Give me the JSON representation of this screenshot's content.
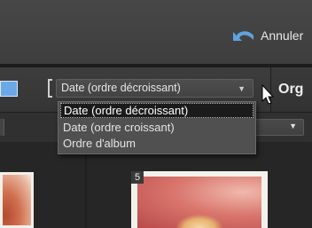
{
  "toolbar": {
    "undo_label": "Annuler",
    "undo_icon": "undo-arrow-icon",
    "workspace_tab_label": "Org"
  },
  "sort": {
    "selected": "Date  (ordre décroissant)",
    "options": [
      "Date  (ordre décroissant)",
      "Date  (ordre croissant)",
      "Ordre d'album"
    ]
  },
  "thumbnails": [
    {
      "badge": ""
    },
    {
      "badge": "5"
    }
  ],
  "colors": {
    "accent_blue": "#6aa9e6",
    "undo_icon_blue": "#5fa3e0",
    "selected_option_bg": "#1b1b1b",
    "list_bg": "#505050"
  }
}
